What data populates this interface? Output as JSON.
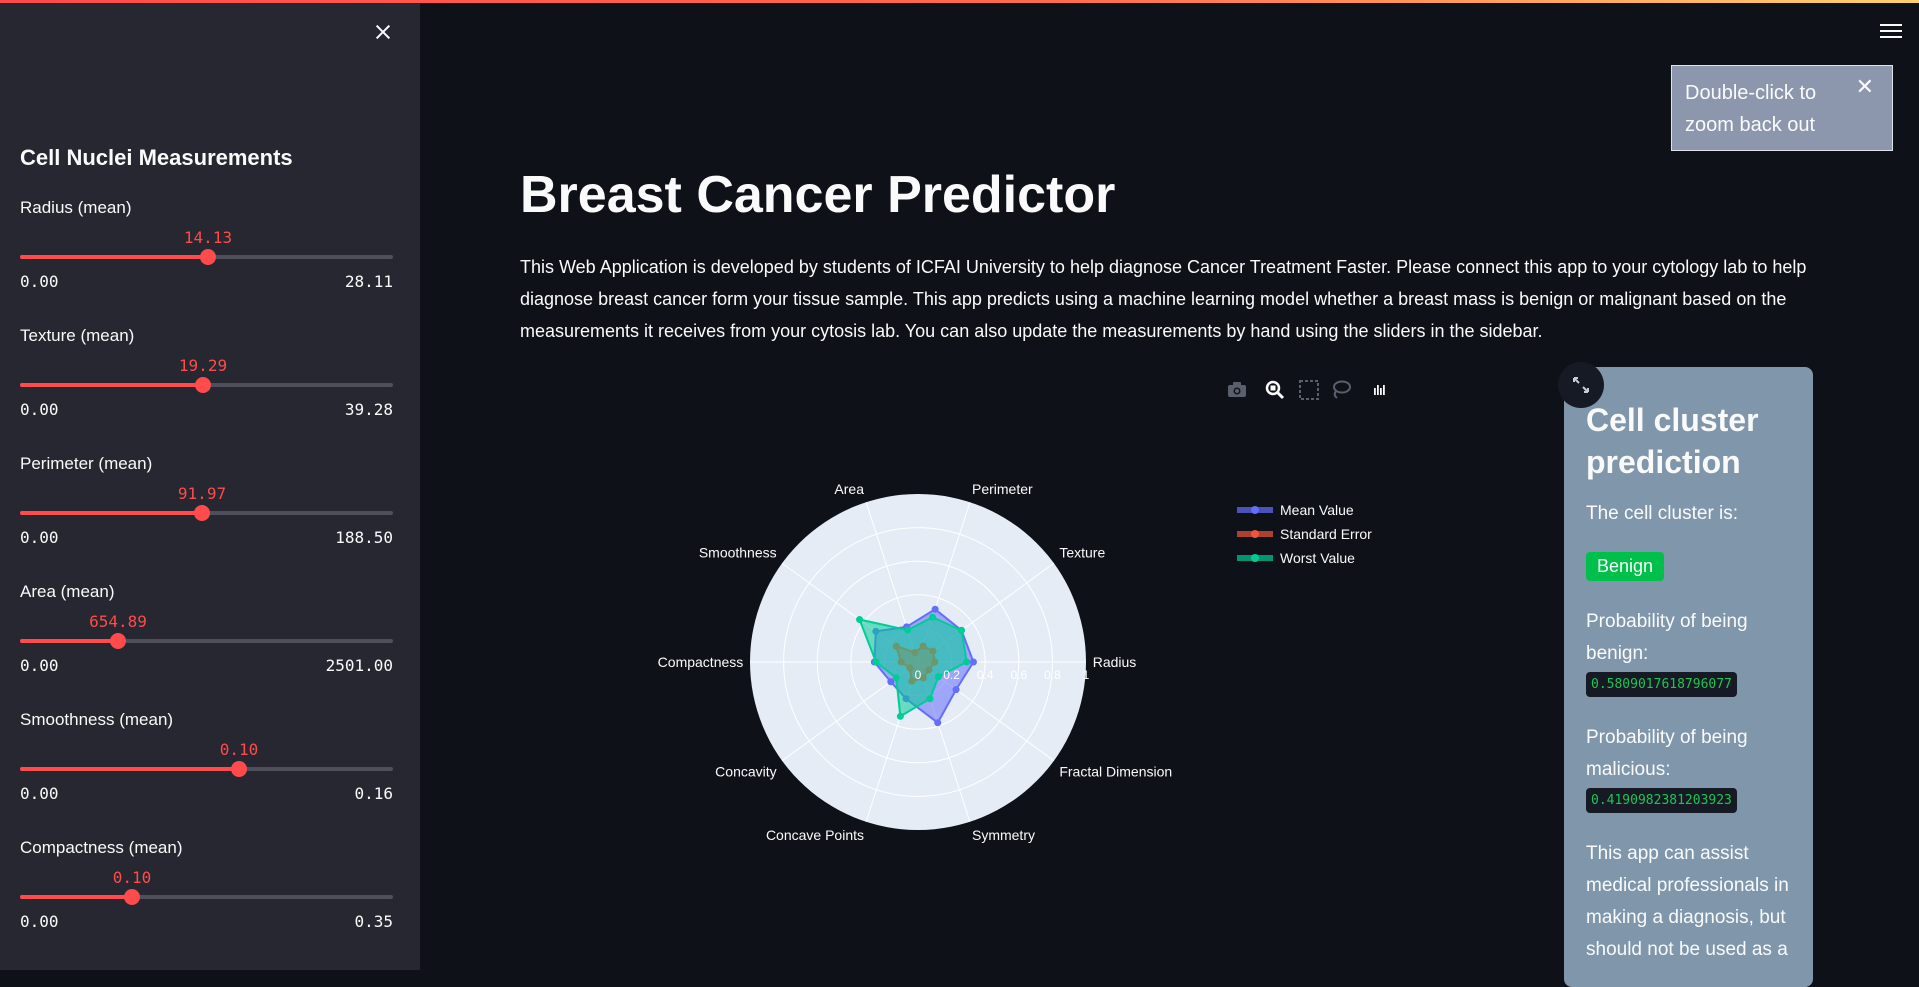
{
  "sidebar": {
    "header": "Cell Nuclei Measurements",
    "sliders": [
      {
        "label": "Radius (mean)",
        "value": "14.13",
        "min": "0.00",
        "max": "28.11",
        "fraction": 0.503
      },
      {
        "label": "Texture (mean)",
        "value": "19.29",
        "min": "0.00",
        "max": "39.28",
        "fraction": 0.491
      },
      {
        "label": "Perimeter (mean)",
        "value": "91.97",
        "min": "0.00",
        "max": "188.50",
        "fraction": 0.488
      },
      {
        "label": "Area (mean)",
        "value": "654.89",
        "min": "0.00",
        "max": "2501.00",
        "fraction": 0.262
      },
      {
        "label": "Smoothness (mean)",
        "value": "0.10",
        "min": "0.00",
        "max": "0.16",
        "fraction": 0.588
      },
      {
        "label": "Compactness (mean)",
        "value": "0.10",
        "min": "0.00",
        "max": "0.35",
        "fraction": 0.3
      }
    ]
  },
  "main": {
    "title": "Breast Cancer Predictor",
    "intro": "This Web Application is developed by students of ICFAI University to help diagnose Cancer Treatment Faster. Please connect this app to your cytology lab to help diagnose breast cancer form your tissue sample. This app predicts using a machine learning model whether a breast mass is benign or malignant based on the measurements it receives from your cytosis lab. You can also update the measurements by hand using the sliders in the sidebar."
  },
  "tooltip": {
    "text_line1": "Double-click to",
    "text_line2": "zoom back out",
    "close": "✕"
  },
  "modebar": [
    "camera-icon",
    "zoom-icon",
    "box-select-icon",
    "lasso-icon",
    "plotly-logo-icon"
  ],
  "prediction": {
    "title": "Cell cluster prediction",
    "cluster_label": "The cell cluster is:",
    "result": "Benign",
    "result_color": "#00c04b",
    "benign_label": "Probability of being benign:",
    "benign_value": "0.5809017618796077",
    "malicious_label": "Probability of being malicious:",
    "malicious_value": "0.4190982381203923",
    "disclaimer": "This app can assist medical professionals in making a diagnosis, but should not be used as a"
  },
  "chart_data": {
    "type": "radar",
    "categories": [
      "Radius",
      "Texture",
      "Perimeter",
      "Area",
      "Smoothness",
      "Compactness",
      "Concavity",
      "Concave Points",
      "Symmetry",
      "Fractal Dimension"
    ],
    "radial_ticks": [
      "0",
      "0.2",
      "0.4",
      "0.6",
      "0.8",
      "1"
    ],
    "radial_range": [
      0,
      1
    ],
    "legend_position": "right",
    "series": [
      {
        "name": "Mean Value",
        "color": "#636efa",
        "values": [
          0.33,
          0.32,
          0.33,
          0.22,
          0.31,
          0.26,
          0.2,
          0.23,
          0.38,
          0.28
        ]
      },
      {
        "name": "Standard Error",
        "color": "#ef553b",
        "values": [
          0.1,
          0.11,
          0.1,
          0.06,
          0.16,
          0.1,
          0.06,
          0.12,
          0.1,
          0.08
        ]
      },
      {
        "name": "Worst Value",
        "color": "#00cc96",
        "values": [
          0.29,
          0.32,
          0.28,
          0.2,
          0.43,
          0.25,
          0.16,
          0.34,
          0.23,
          0.15
        ]
      }
    ]
  }
}
